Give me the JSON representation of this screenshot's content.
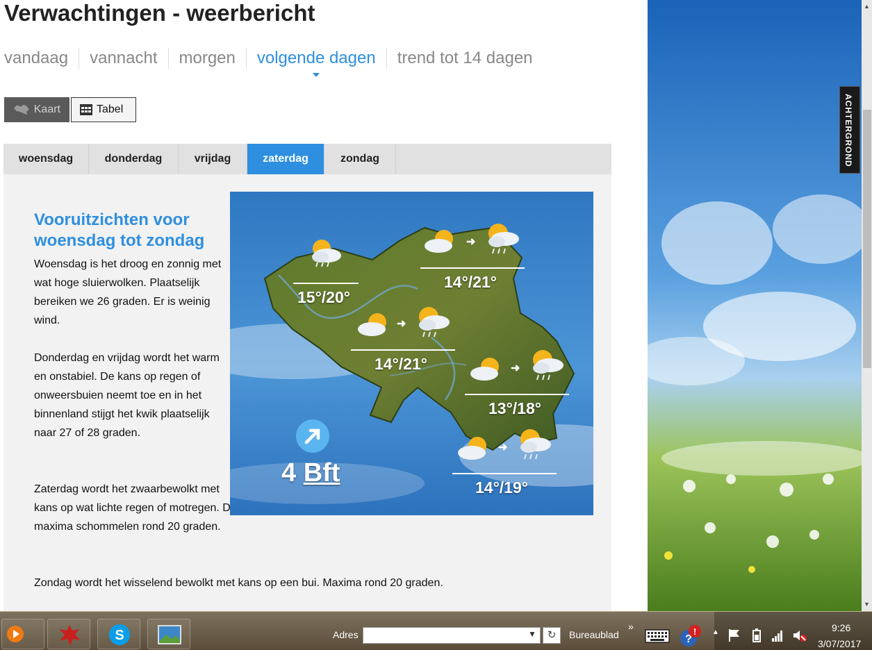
{
  "page_title": "Verwachtingen - weerbericht",
  "nav": [
    {
      "label": "vandaag"
    },
    {
      "label": "vannacht"
    },
    {
      "label": "morgen"
    },
    {
      "label": "volgende dagen",
      "active": true
    },
    {
      "label": "trend tot 14 dagen"
    }
  ],
  "view_toggle": {
    "map_label": "Kaart",
    "table_label": "Tabel"
  },
  "day_tabs": [
    {
      "label": "woensdag"
    },
    {
      "label": "donderdag"
    },
    {
      "label": "vrijdag"
    },
    {
      "label": "zaterdag",
      "active": true
    },
    {
      "label": "zondag"
    }
  ],
  "forecast": {
    "heading": "Vooruitzichten voor woensdag tot zondag",
    "paragraphs": [
      "Woensdag is het droog en zonnig met wat hoge sluierwolken. Plaatselijk bereiken we 26 graden. Er is weinig wind.",
      "Donderdag en vrijdag wordt het warm en onstabiel. De kans op regen of onweersbuien neemt toe en in het binnenland stijgt het kwik plaatselijk naar 27 of 28 graden.",
      "Zaterdag wordt het zwaarbewolkt met kans op wat lichte regen of motregen. De maxima schommelen rond 20 graden.",
      "Zondag wordt het wisselend bewolkt met kans op een bui. Maxima rond 20 graden."
    ]
  },
  "map": {
    "regions": [
      {
        "temps": "15°/20°",
        "icons": [
          "sun-cloud-rain-icon"
        ]
      },
      {
        "temps": "14°/21°",
        "icons": [
          "sun-cloud-icon",
          "sun-cloud-rain-icon"
        ]
      },
      {
        "temps": "14°/21°",
        "icons": [
          "sun-cloud-icon",
          "sun-cloud-rain-icon"
        ]
      },
      {
        "temps": "13°/18°",
        "icons": [
          "sun-cloud-icon",
          "sun-cloud-rain-icon"
        ]
      },
      {
        "temps": "14°/19°",
        "icons": [
          "sun-cloud-icon",
          "sun-cloud-rain-icon"
        ]
      }
    ],
    "wind": {
      "value": "4",
      "unit": "Bft"
    }
  },
  "side": {
    "background_tab": "ACHTERGROND"
  },
  "taskbar": {
    "address_label": "Adres",
    "address_value": "",
    "desktop_label": "Bureaublad",
    "time": "9:26",
    "date": "3/07/2017"
  },
  "colors": {
    "accent": "#2e8fe0",
    "tab_bg": "#e1e1e1",
    "panel_bg": "#f2f2f2"
  }
}
